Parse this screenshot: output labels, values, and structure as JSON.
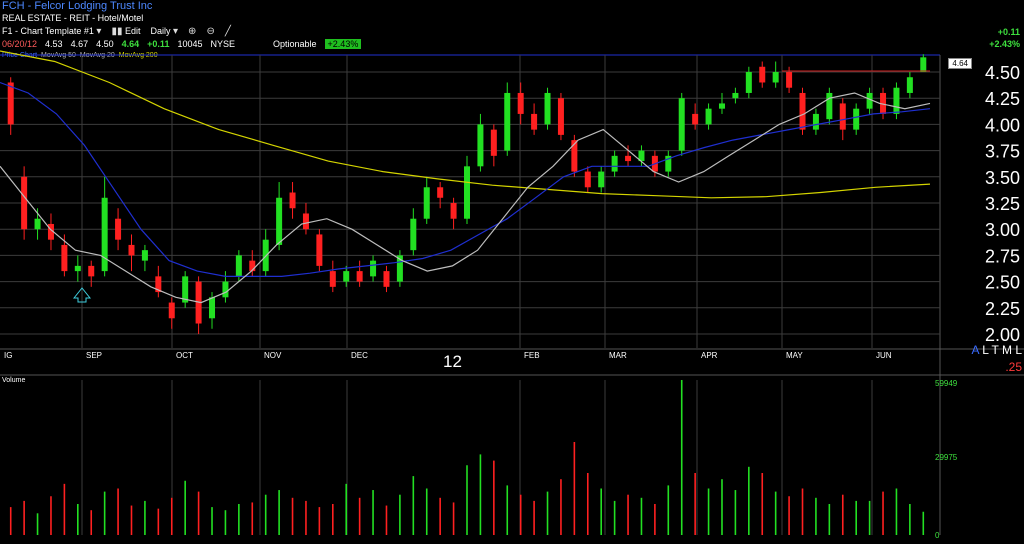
{
  "header": {
    "symbol_title": "FCH - Felcor Lodging Trust Inc",
    "industry": "REAL ESTATE - REIT - Hotel/Motel",
    "template_label": "F1 - Chart Template #1",
    "edit_label": "Edit",
    "period_label": "Daily",
    "icons": [
      "dropdown-arrow-icon",
      "bar-chart-icon",
      "zoom-in-icon",
      "zoom-out-icon",
      "draw-line-icon"
    ]
  },
  "quote": {
    "date": "06/20/12",
    "open": "4.53",
    "high": "4.67",
    "low": "4.50",
    "close": "4.64",
    "change": "+0.11",
    "volume": "10045",
    "exchange": "NYSE",
    "optionable_label": "Optionable",
    "pct_badge": "+2.43%"
  },
  "header_change": {
    "abs": "+0.11",
    "pct": "+2.43%"
  },
  "legend": {
    "l1": "Price Chart",
    "l2": "MovAvg 50",
    "l3": "MovAvg 20",
    "l4": "MovAvg 200"
  },
  "last_price_tag": "4.64",
  "year_label": "12",
  "corner_text": ".25",
  "altml": {
    "a": "A",
    "rest": "L T M L"
  },
  "volume_label": "Volume",
  "colors": {
    "up": "#22e022",
    "down": "#ff2020",
    "ma50": "#1f2fd0",
    "ma20": "#bdbdbd",
    "ma200": "#d4d400",
    "grid": "#3c3c3c"
  },
  "chart_data": {
    "type": "candlestick",
    "y_axis": {
      "ticks": [
        "4.50",
        "4.25",
        "4.00",
        "3.75",
        "3.50",
        "3.25",
        "3.00",
        "2.75",
        "2.50",
        "2.25",
        "2.00"
      ],
      "ylim": [
        1.95,
        4.6
      ]
    },
    "month_labels": [
      "IG",
      "SEP",
      "OCT",
      "NOV",
      "DEC",
      "FEB",
      "MAR",
      "APR",
      "MAY",
      "JUN"
    ],
    "volume_axis": {
      "ticks": [
        "59949",
        "29975",
        "0"
      ],
      "max": 59949
    },
    "series": [
      {
        "name": "Price",
        "values": "OHLC candles listed under candles"
      },
      {
        "name": "MovAvg 20",
        "values": [
          3.6,
          3.3,
          3.0,
          2.8,
          2.75,
          2.6,
          2.45,
          2.35,
          2.3,
          2.4,
          2.6,
          2.85,
          3.05,
          3.1,
          3.0,
          2.85,
          2.7,
          2.6,
          2.65,
          2.8,
          3.1,
          3.4,
          3.6,
          3.85,
          3.95,
          3.75,
          3.55,
          3.45,
          3.55,
          3.7,
          3.85,
          4.0,
          4.1,
          4.25,
          4.3,
          4.2,
          4.15,
          4.2
        ]
      },
      {
        "name": "MovAvg 50",
        "values": [
          4.4,
          4.3,
          4.1,
          3.8,
          3.4,
          3.0,
          2.7,
          2.6,
          2.55,
          2.55,
          2.55,
          2.58,
          2.62,
          2.65,
          2.68,
          2.72,
          2.8,
          2.95,
          3.1,
          3.3,
          3.5,
          3.6,
          3.6,
          3.6,
          3.7,
          3.78,
          3.85,
          3.9,
          3.95,
          4.0,
          4.05,
          4.1,
          4.12,
          4.15
        ]
      },
      {
        "name": "MovAvg 200",
        "values": [
          4.7,
          4.6,
          4.4,
          4.15,
          3.95,
          3.8,
          3.65,
          3.55,
          3.48,
          3.42,
          3.38,
          3.34,
          3.32,
          3.3,
          3.31,
          3.35,
          3.4,
          3.43
        ]
      }
    ],
    "candles": [
      [
        4.4,
        4.0,
        4.45,
        3.9
      ],
      [
        3.5,
        3.0,
        3.6,
        2.9
      ],
      [
        3.0,
        3.1,
        3.2,
        2.9
      ],
      [
        3.05,
        2.9,
        3.15,
        2.8
      ],
      [
        2.85,
        2.6,
        2.95,
        2.55
      ],
      [
        2.6,
        2.65,
        2.75,
        2.5
      ],
      [
        2.65,
        2.55,
        2.7,
        2.45
      ],
      [
        2.6,
        3.3,
        3.5,
        2.55
      ],
      [
        3.1,
        2.9,
        3.2,
        2.8
      ],
      [
        2.85,
        2.75,
        2.95,
        2.6
      ],
      [
        2.7,
        2.8,
        2.85,
        2.6
      ],
      [
        2.55,
        2.4,
        2.65,
        2.35
      ],
      [
        2.3,
        2.15,
        2.35,
        2.05
      ],
      [
        2.3,
        2.55,
        2.6,
        2.25
      ],
      [
        2.5,
        2.1,
        2.55,
        2.0
      ],
      [
        2.15,
        2.35,
        2.4,
        2.05
      ],
      [
        2.35,
        2.5,
        2.6,
        2.3
      ],
      [
        2.55,
        2.75,
        2.8,
        2.5
      ],
      [
        2.7,
        2.6,
        2.8,
        2.55
      ],
      [
        2.6,
        2.9,
        3.0,
        2.55
      ],
      [
        2.85,
        3.3,
        3.45,
        2.8
      ],
      [
        3.35,
        3.2,
        3.45,
        3.1
      ],
      [
        3.15,
        3.0,
        3.25,
        2.95
      ],
      [
        2.95,
        2.65,
        3.0,
        2.6
      ],
      [
        2.6,
        2.45,
        2.7,
        2.4
      ],
      [
        2.5,
        2.6,
        2.65,
        2.45
      ],
      [
        2.6,
        2.5,
        2.7,
        2.45
      ],
      [
        2.55,
        2.7,
        2.75,
        2.5
      ],
      [
        2.6,
        2.45,
        2.65,
        2.4
      ],
      [
        2.5,
        2.75,
        2.8,
        2.45
      ],
      [
        2.8,
        3.1,
        3.2,
        2.75
      ],
      [
        3.1,
        3.4,
        3.5,
        3.05
      ],
      [
        3.4,
        3.3,
        3.45,
        3.2
      ],
      [
        3.25,
        3.1,
        3.3,
        3.0
      ],
      [
        3.1,
        3.6,
        3.7,
        3.05
      ],
      [
        3.6,
        4.0,
        4.1,
        3.55
      ],
      [
        3.95,
        3.7,
        4.0,
        3.6
      ],
      [
        3.75,
        4.3,
        4.4,
        3.7
      ],
      [
        4.3,
        4.1,
        4.4,
        4.0
      ],
      [
        4.1,
        3.95,
        4.2,
        3.9
      ],
      [
        4.0,
        4.3,
        4.35,
        3.95
      ],
      [
        4.25,
        3.9,
        4.3,
        3.85
      ],
      [
        3.85,
        3.55,
        3.9,
        3.5
      ],
      [
        3.55,
        3.4,
        3.6,
        3.35
      ],
      [
        3.4,
        3.55,
        3.6,
        3.35
      ],
      [
        3.55,
        3.7,
        3.75,
        3.5
      ],
      [
        3.7,
        3.65,
        3.8,
        3.6
      ],
      [
        3.65,
        3.75,
        3.8,
        3.6
      ],
      [
        3.7,
        3.55,
        3.75,
        3.5
      ],
      [
        3.55,
        3.7,
        3.75,
        3.5
      ],
      [
        3.75,
        4.25,
        4.3,
        3.7
      ],
      [
        4.1,
        4.0,
        4.2,
        3.95
      ],
      [
        4.0,
        4.15,
        4.2,
        3.95
      ],
      [
        4.15,
        4.2,
        4.3,
        4.1
      ],
      [
        4.25,
        4.3,
        4.35,
        4.2
      ],
      [
        4.3,
        4.5,
        4.55,
        4.25
      ],
      [
        4.55,
        4.4,
        4.6,
        4.35
      ],
      [
        4.4,
        4.5,
        4.6,
        4.35
      ],
      [
        4.5,
        4.35,
        4.55,
        4.3
      ],
      [
        4.3,
        3.95,
        4.35,
        3.9
      ],
      [
        3.95,
        4.1,
        4.15,
        3.9
      ],
      [
        4.05,
        4.3,
        4.35,
        4.0
      ],
      [
        4.2,
        3.95,
        4.25,
        3.85
      ],
      [
        3.95,
        4.15,
        4.2,
        3.9
      ],
      [
        4.15,
        4.3,
        4.35,
        4.1
      ],
      [
        4.3,
        4.1,
        4.35,
        4.05
      ],
      [
        4.1,
        4.35,
        4.4,
        4.05
      ],
      [
        4.3,
        4.45,
        4.5,
        4.25
      ],
      [
        4.5,
        4.64,
        4.67,
        4.5
      ]
    ],
    "volumes": [
      0.18,
      0.22,
      0.14,
      0.25,
      0.33,
      0.2,
      0.16,
      0.28,
      0.3,
      0.19,
      0.22,
      0.17,
      0.24,
      0.35,
      0.28,
      0.18,
      0.16,
      0.2,
      0.21,
      0.26,
      0.29,
      0.24,
      0.22,
      0.18,
      0.2,
      0.33,
      0.24,
      0.29,
      0.19,
      0.26,
      0.38,
      0.3,
      0.24,
      0.21,
      0.45,
      0.52,
      0.48,
      0.32,
      0.26,
      0.22,
      0.28,
      0.36,
      0.6,
      0.4,
      0.3,
      0.22,
      0.26,
      0.24,
      0.2,
      0.32,
      1.0,
      0.4,
      0.3,
      0.36,
      0.29,
      0.44,
      0.4,
      0.28,
      0.25,
      0.3,
      0.24,
      0.2,
      0.26,
      0.22,
      0.22,
      0.28,
      0.3,
      0.2,
      0.15
    ]
  }
}
